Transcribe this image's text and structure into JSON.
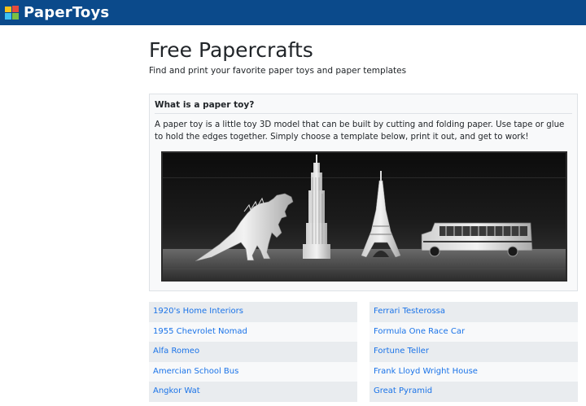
{
  "brand": {
    "name": "PaperToys"
  },
  "page": {
    "title": "Free Papercrafts",
    "subtitle": "Find and print your favorite paper toys and paper templates"
  },
  "card": {
    "header": "What is a paper toy?",
    "text": "A paper toy is a little toy 3D model that can be built by cutting and folding paper. Use tape or glue to hold the edges together. Simply choose a template below, print it out, and get to work!"
  },
  "lists": {
    "left": [
      "1920's Home Interiors",
      "1955 Chevrolet Nomad",
      "Alfa Romeo",
      "Amercian School Bus",
      "Angkor Wat"
    ],
    "right": [
      "Ferrari Testerossa",
      "Formula One Race Car",
      "Fortune Teller",
      "Frank Lloyd Wright House",
      "Great Pyramid"
    ]
  },
  "colors": {
    "navbar": "#0b4a8b",
    "link": "#1a73e8"
  }
}
